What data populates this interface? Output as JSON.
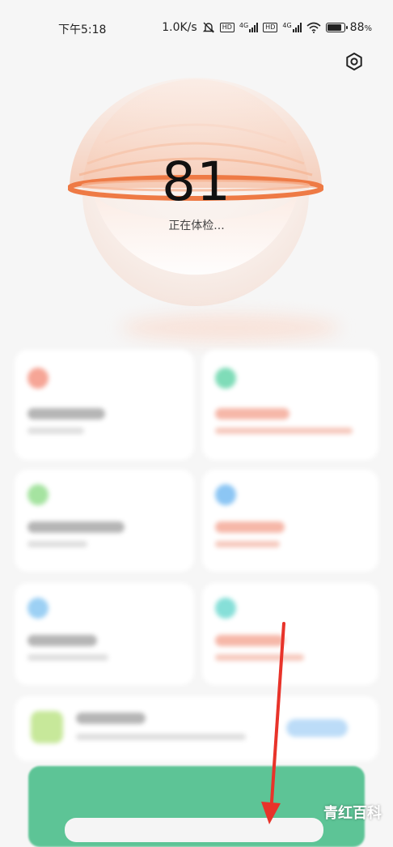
{
  "status_bar": {
    "time": "下午5:18",
    "speed": "1.0K/s",
    "hd1": "HD",
    "net1": "4G",
    "hd2": "HD",
    "net2": "4G",
    "battery": "88",
    "battery_unit": "%",
    "battery_level": 0.88
  },
  "header": {
    "settings_icon": "settings-hex-icon"
  },
  "scan": {
    "score": "81",
    "status": "正在体检..."
  },
  "colors": {
    "ring": "#ee7a45",
    "banner": "#5dc496"
  },
  "watermark": "青红百科"
}
